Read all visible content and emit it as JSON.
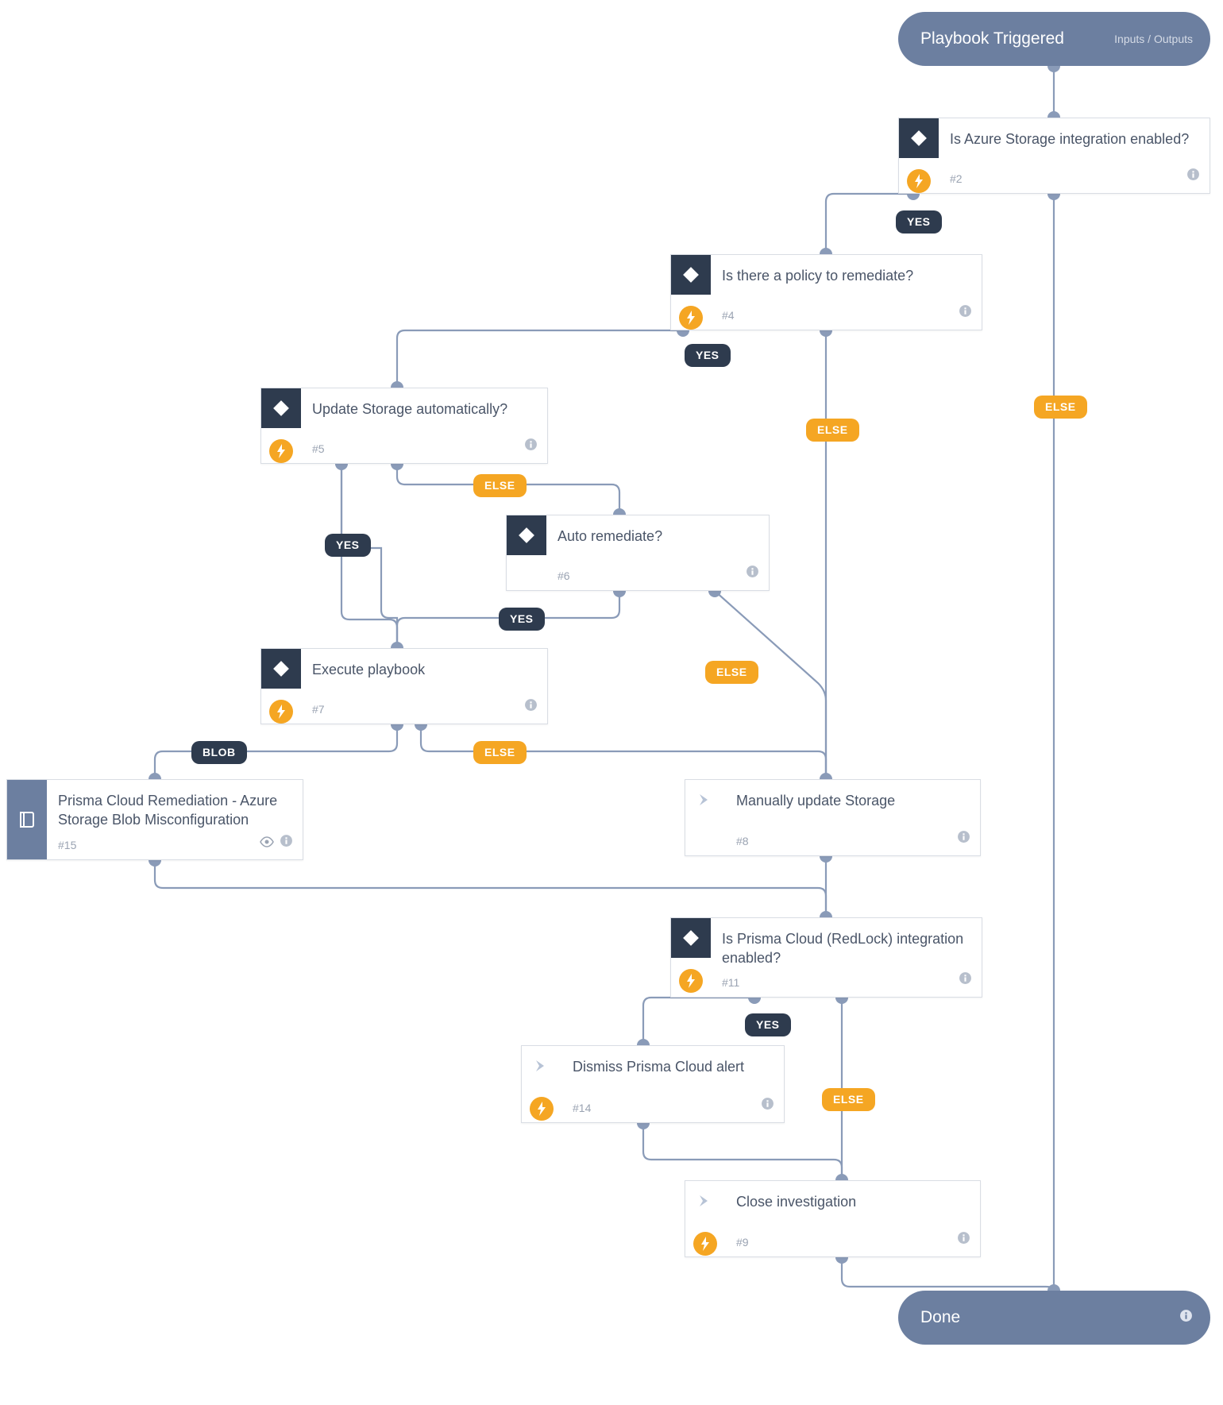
{
  "colors": {
    "pill": "#6c7fa0",
    "card_bg": "#ffffff",
    "card_border": "#d9dde4",
    "dark": "#2e3b4e",
    "orange": "#f5a623",
    "connector": "#8a9bb8",
    "text": "#4a5568",
    "muted": "#9aa3b2"
  },
  "start": {
    "title": "Playbook Triggered",
    "sub": "Inputs / Outputs"
  },
  "end": {
    "title": "Done"
  },
  "nodes": {
    "n2": {
      "title": "Is Azure Storage integration enabled?",
      "num": "#2",
      "kind": "cond"
    },
    "n4": {
      "title": "Is there a policy to remediate?",
      "num": "#4",
      "kind": "cond"
    },
    "n5": {
      "title": "Update Storage automatically?",
      "num": "#5",
      "kind": "cond"
    },
    "n6": {
      "title": "Auto remediate?",
      "num": "#6",
      "kind": "cond_plain"
    },
    "n7": {
      "title": "Execute playbook",
      "num": "#7",
      "kind": "cond"
    },
    "n15": {
      "title": "Prisma Cloud Remediation - Azure Storage Blob Misconfiguration",
      "num": "#15",
      "kind": "book"
    },
    "n8": {
      "title": "Manually update Storage",
      "num": "#8",
      "kind": "task_plain"
    },
    "n11": {
      "title": "Is Prisma Cloud (RedLock) integration enabled?",
      "num": "#11",
      "kind": "cond"
    },
    "n14": {
      "title": "Dismiss Prisma Cloud alert",
      "num": "#14",
      "kind": "task"
    },
    "n9": {
      "title": "Close investigation",
      "num": "#9",
      "kind": "task"
    }
  },
  "labels": {
    "yes": "YES",
    "else": "ELSE",
    "blob": "BLOB"
  }
}
